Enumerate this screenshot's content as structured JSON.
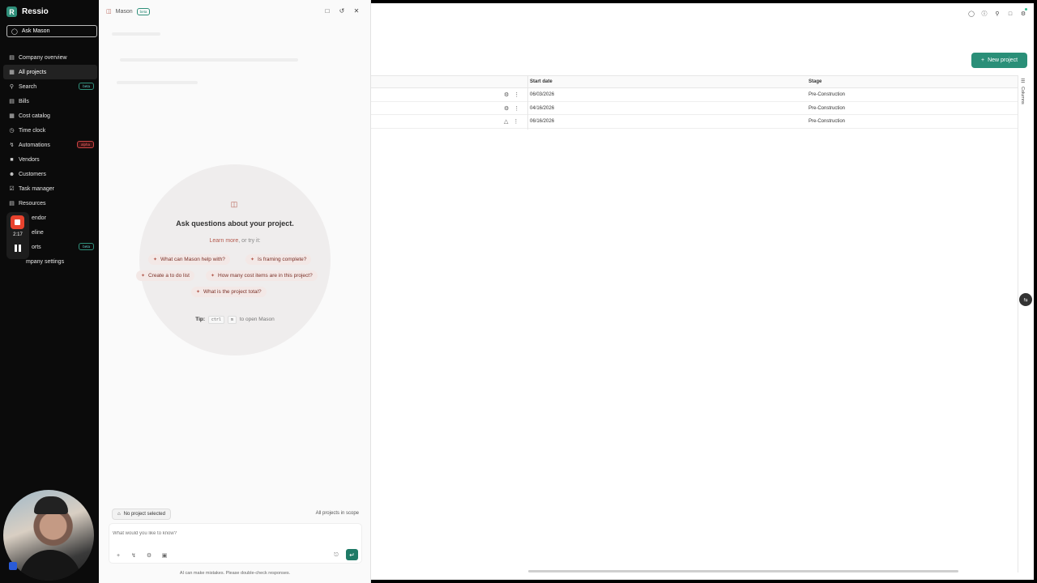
{
  "app": {
    "name": "Ressio",
    "logo_letter": "R"
  },
  "sidebar": {
    "ask_label": "Ask Mason",
    "items": [
      {
        "label": "Company overview",
        "icon": "chart-icon"
      },
      {
        "label": "All projects",
        "icon": "folder-icon",
        "active": true
      },
      {
        "label": "Search",
        "icon": "search-icon",
        "badge": "beta"
      },
      {
        "label": "Bills",
        "icon": "bill-icon"
      },
      {
        "label": "Cost catalog",
        "icon": "catalog-icon"
      },
      {
        "label": "Time clock",
        "icon": "clock-icon"
      },
      {
        "label": "Automations",
        "icon": "bolt-icon",
        "badge": "alpha"
      },
      {
        "label": "Vendors",
        "icon": "vendor-icon"
      },
      {
        "label": "Customers",
        "icon": "customers-icon"
      },
      {
        "label": "Task manager",
        "icon": "task-icon"
      },
      {
        "label": "Resources",
        "icon": "resources-icon"
      },
      {
        "label": "endor",
        "icon": "calendar-icon"
      },
      {
        "label": "eline",
        "icon": "timeline-icon"
      },
      {
        "label": "orts",
        "icon": "reports-icon",
        "badge": "beta"
      },
      {
        "label": "mpany settings",
        "icon": "settings-icon"
      }
    ]
  },
  "recorder": {
    "time": "2:17"
  },
  "mason": {
    "title": "Mason",
    "beta": "beta",
    "heading": "Ask questions about your project.",
    "learn_more": "Learn more",
    "or_try": ", or try it:",
    "suggestions": [
      "What can Mason help with?",
      "Is framing complete?",
      "Create a to do list",
      "How many cost items are in this project?",
      "What is the project total?"
    ],
    "tip_label": "Tip:",
    "tip_key1": "ctrl",
    "tip_key2": "m",
    "tip_text": "to open Mason",
    "scope_chip": "No project selected",
    "scope_right": "All projects in scope",
    "input_placeholder": "What would you like to know?",
    "disclaimer": "AI can make mistakes. Please double-check responses."
  },
  "main": {
    "new_project": "New project",
    "columns_label": "Columns",
    "headers": {
      "start_date": "Start date",
      "stage": "Stage"
    },
    "rows": [
      {
        "start_date": "06/03/2026",
        "stage": "Pre-Construction"
      },
      {
        "start_date": "04/16/2026",
        "stage": "Pre-Construction"
      },
      {
        "start_date": "06/16/2026",
        "stage": "Pre-Construction"
      }
    ]
  },
  "colors": {
    "accent": "#2a8f78",
    "mason_accent": "#b45a4e",
    "sidebar_bg": "#0b0b0b"
  }
}
